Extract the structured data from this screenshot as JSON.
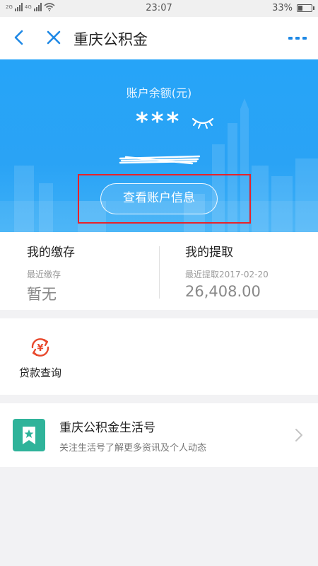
{
  "status_bar": {
    "network_left": "2G",
    "network_right": "4G",
    "time": "23:07",
    "battery_text": "33%",
    "battery_level": 0.33
  },
  "header": {
    "title": "重庆公积金",
    "icons": [
      "back-icon",
      "close-icon",
      "more-icon"
    ]
  },
  "hero": {
    "balance_label": "账户余额(元)",
    "balance_hidden": "***",
    "view_button_label": "查看账户信息",
    "colors": {
      "background": "#26a4f8",
      "highlight_frame": "#e8222a"
    }
  },
  "stats": {
    "deposit": {
      "title": "我的缴存",
      "sub": "最近缴存",
      "value": "暂无"
    },
    "withdraw": {
      "title": "我的提取",
      "sub": "最近提取2017-02-20",
      "value": "26,408.00"
    }
  },
  "services": {
    "loan": {
      "label": "贷款查询",
      "icon": "yuan-refresh-icon",
      "color": "#e8482c"
    }
  },
  "life_account": {
    "title": "重庆公积金生活号",
    "subtitle": "关注生活号了解更多资讯及个人动态",
    "icon": "bookmark-star-icon",
    "color": "#2fb39a"
  }
}
